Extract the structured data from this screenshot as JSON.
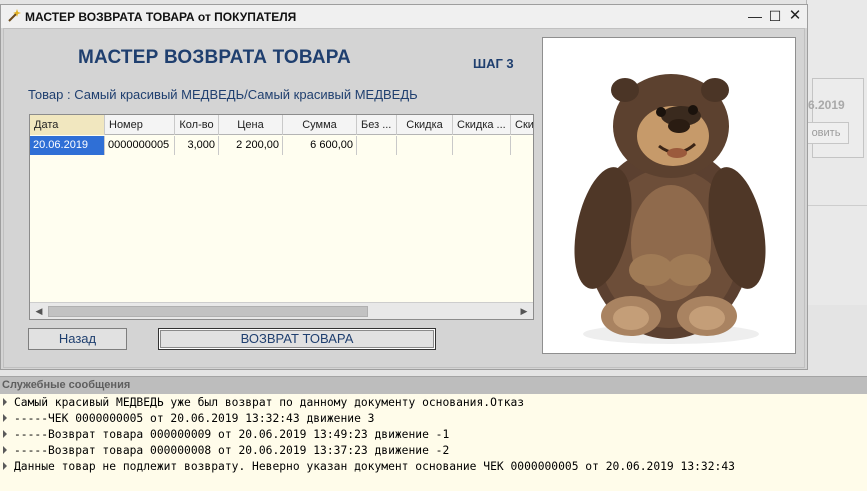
{
  "background_app": {
    "date_fragment": "6.2019",
    "button_fragment": "овить"
  },
  "window": {
    "title": "МАСТЕР ВОЗВРАТА ТОВАРА от ПОКУПАТЕЛЯ",
    "controls": {
      "minimize": "—",
      "maximize": "☐",
      "close": "✕"
    }
  },
  "wizard": {
    "heading": "МАСТЕР ВОЗВРАТА ТОВАРА",
    "step": "ШАГ 3",
    "product_line": "Товар : Самый красивый МЕДВЕДЬ/Самый красивый МЕДВЕДЬ"
  },
  "grid": {
    "columns": [
      "Дата",
      "Номер",
      "Кол-во",
      "Цена",
      "Сумма",
      "Без ...",
      "Скидка",
      "Скидка ...",
      "Ски"
    ],
    "rows": [
      [
        "20.06.2019",
        "0000000005",
        "3,000",
        "2 200,00",
        "6 600,00",
        "",
        "",
        "",
        ""
      ]
    ]
  },
  "buttons": {
    "back": "Назад",
    "return": "ВОЗВРАТ ТОВАРА"
  },
  "messages": {
    "title": "Служебные сообщения",
    "lines": [
      "Самый красивый МЕДВЕДЬ уже был возврат по данному документу основания.Отказ",
      "-----ЧЕК 0000000005 от 20.06.2019 13:32:43 движение 3",
      "-----Возврат товара 000000009 от 20.06.2019 13:49:23 движение -1",
      "-----Возврат товара 000000008 от 20.06.2019 13:37:23 движение -2",
      "Данные товар не подлежит возврату. Неверно указан документ основание ЧЕК 0000000005 от 20.06.2019 13:32:43"
    ]
  },
  "colors": {
    "accent_text": "#1f3f6f",
    "selected_cell": "#2f6fd6",
    "grid_background": "#fffef0",
    "message_background": "#fffcea"
  }
}
